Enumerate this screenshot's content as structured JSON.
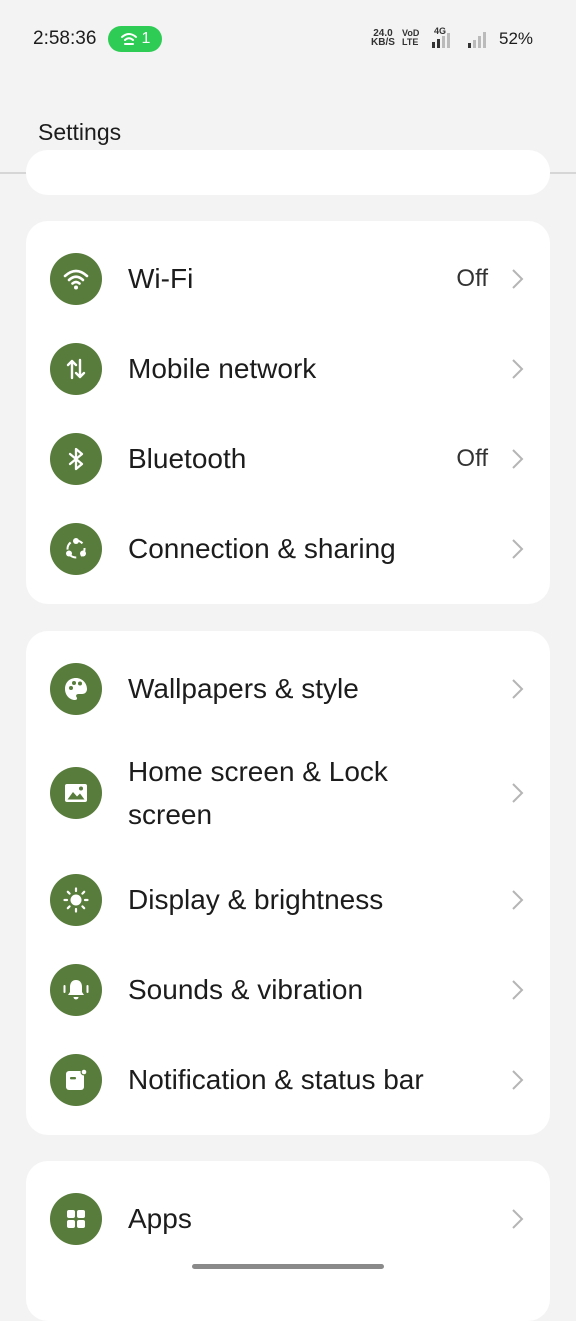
{
  "status_bar": {
    "time": "2:58:36",
    "hotspot_count": "1",
    "net_speed_value": "24.0",
    "net_speed_unit": "KB/S",
    "volte_top": "VoD",
    "volte_bottom": "LTE",
    "network_type": "4G",
    "battery": "52%",
    "hotspot_color": "#2ecc55"
  },
  "header": {
    "title": "Settings"
  },
  "theme": {
    "icon_bg": "#587c3b",
    "card_bg": "#ffffff",
    "page_bg": "#f3f3f3"
  },
  "groups": [
    {
      "items": [
        {
          "label": "Wi-Fi",
          "value": "Off",
          "icon": "wifi-icon"
        },
        {
          "label": "Mobile network",
          "value": "",
          "icon": "mobile-data-icon"
        },
        {
          "label": "Bluetooth",
          "value": "Off",
          "icon": "bluetooth-icon"
        },
        {
          "label": "Connection & sharing",
          "value": "",
          "icon": "share-icon"
        }
      ]
    },
    {
      "items": [
        {
          "label": "Wallpapers & style",
          "value": "",
          "icon": "palette-icon"
        },
        {
          "label": "Home screen & Lock screen",
          "value": "",
          "icon": "image-icon"
        },
        {
          "label": "Display & brightness",
          "value": "",
          "icon": "sun-icon"
        },
        {
          "label": "Sounds & vibration",
          "value": "",
          "icon": "bell-icon"
        },
        {
          "label": "Notification & status bar",
          "value": "",
          "icon": "notification-icon"
        }
      ]
    },
    {
      "items": [
        {
          "label": "Apps",
          "value": "",
          "icon": "apps-icon"
        }
      ]
    }
  ]
}
